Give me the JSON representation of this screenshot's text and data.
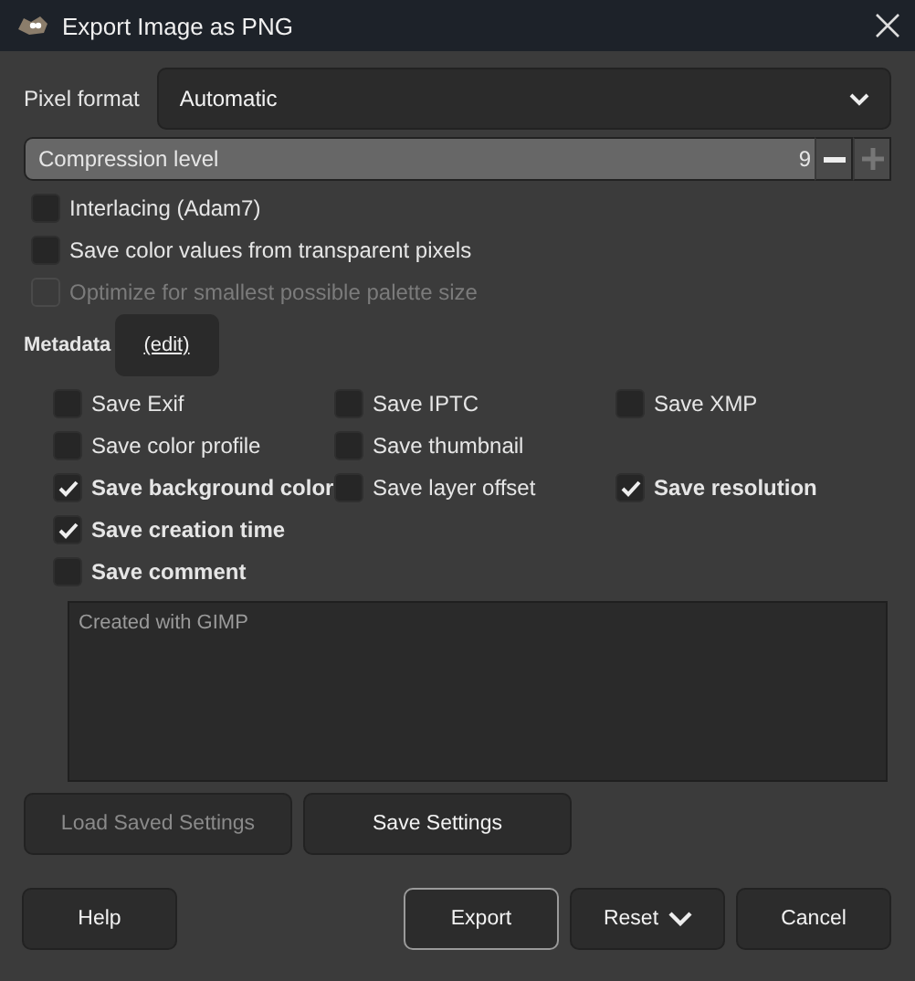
{
  "window": {
    "title": "Export Image as PNG"
  },
  "pixel_format": {
    "label": "Pixel format",
    "value": "Automatic"
  },
  "compression": {
    "label": "Compression level",
    "reading": "9",
    "level": 1
  },
  "options": [
    {
      "label": "Interlacing (Adam7)",
      "checked": false,
      "disabled": false
    },
    {
      "label": "Save color values from transparent pixels",
      "checked": false,
      "disabled": false
    },
    {
      "label": "Optimize for smallest possible palette size",
      "checked": false,
      "disabled": true
    }
  ],
  "metadata": {
    "label": "Metadata",
    "edit_link": "(edit)",
    "rows": [
      [
        {
          "label": "Save Exif",
          "checked": false,
          "bold": false
        },
        {
          "label": "Save IPTC",
          "checked": false,
          "bold": false
        },
        {
          "label": "Save XMP",
          "checked": false,
          "bold": false
        }
      ],
      [
        {
          "label": "Save color profile",
          "checked": false,
          "bold": false
        },
        {
          "label": "Save thumbnail",
          "checked": false,
          "bold": false
        }
      ],
      [
        {
          "label": "Save background color",
          "checked": true,
          "bold": true
        },
        {
          "label": "Save layer offset",
          "checked": false,
          "bold": false
        },
        {
          "label": "Save resolution",
          "checked": true,
          "bold": true
        }
      ],
      [
        {
          "label": "Save creation time",
          "checked": true,
          "bold": true
        }
      ],
      [
        {
          "label": "Save comment",
          "checked": false,
          "bold": true
        }
      ]
    ]
  },
  "comment": {
    "value": "Created with GIMP"
  },
  "settings_buttons": [
    {
      "label": "Load Saved Settings",
      "disabled": true
    },
    {
      "label": "Save Settings",
      "disabled": false
    }
  ],
  "buttons": [
    {
      "label": "Help",
      "kind": "plain"
    },
    {
      "label": "Export",
      "kind": "default"
    },
    {
      "label": "Reset",
      "kind": "menu"
    },
    {
      "label": "Cancel",
      "kind": "plain"
    }
  ]
}
